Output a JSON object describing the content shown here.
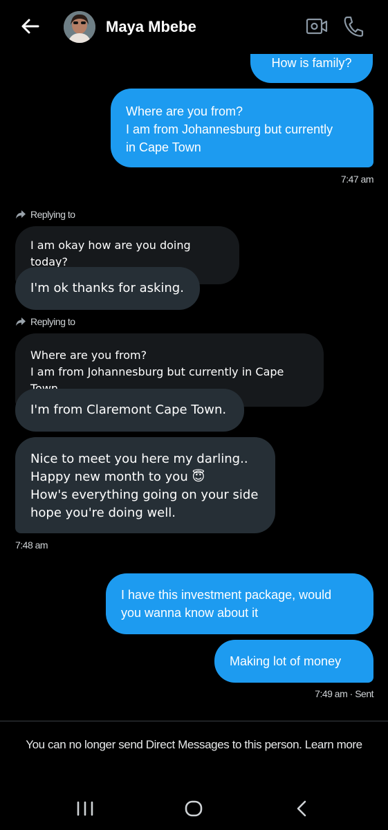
{
  "header": {
    "contact_name": "Maya Mbebe",
    "back_icon": "arrow-left-icon",
    "video_icon": "video-call-icon",
    "phone_icon": "phone-icon"
  },
  "messages": {
    "out_1": "How is family?",
    "out_2": "Where are you from?\nI am from Johannesburg but currently\nin Cape Town",
    "time_1": "7:47 am",
    "replying_to_1": "Replying to",
    "quote_1": "I am okay how are you doing today?",
    "in_1": "I'm ok thanks for asking.",
    "replying_to_2": "Replying to",
    "quote_2": "Where are you from?\nI am from Johannesburg but currently in Cape Town",
    "in_2": "I'm from Claremont Cape Town.",
    "in_3": "Nice to meet you here my darling..\nHappy new month to you 😇\n  How's everything going on your side\nhope you're doing well.",
    "time_2": "7:48 am",
    "out_3": "I have this investment package, would\nyou wanna know about it",
    "out_4": "Making lot of money",
    "time_3": "7:49 am · Sent"
  },
  "notice": {
    "text": "You can no longer send Direct Messages to this person. Learn",
    "link": "more"
  },
  "colors": {
    "background": "#000000",
    "outgoing_bubble": "#1d9bf0",
    "incoming_bubble": "#262f36",
    "quoted_bubble": "#16191c"
  },
  "navbar": {
    "recents_icon": "recent-apps-icon",
    "home_icon": "home-icon",
    "back_icon": "nav-back-icon"
  }
}
